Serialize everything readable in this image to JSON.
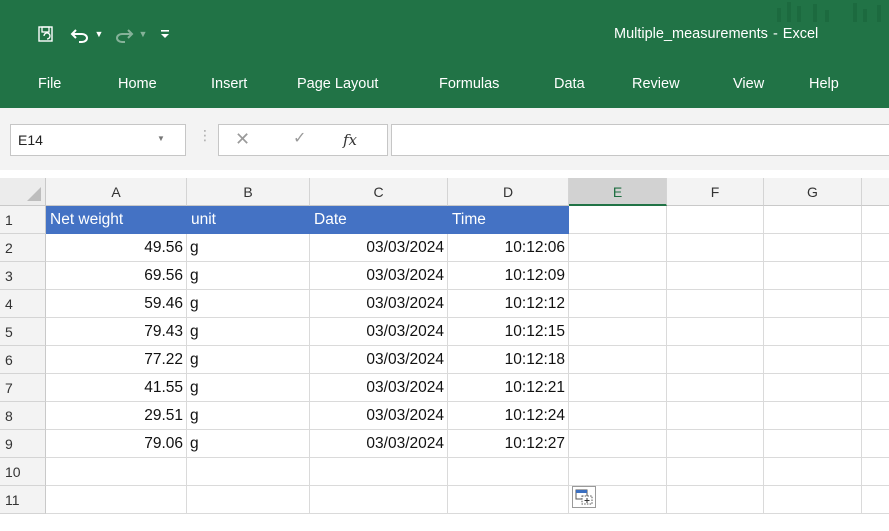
{
  "window": {
    "filename": "Multiple_measurements",
    "separator": "-",
    "app_name": "Excel"
  },
  "qat": {
    "save_icon": "save-icon",
    "undo_icon": "undo-icon",
    "redo_icon": "redo-icon",
    "customize_icon": "customize-qat-icon"
  },
  "ribbon": {
    "tabs": [
      "File",
      "Home",
      "Insert",
      "Page Layout",
      "Formulas",
      "Data",
      "Review",
      "View",
      "Help"
    ]
  },
  "formula_bar": {
    "name_box": "E14",
    "cancel_icon": "cancel-icon",
    "enter_icon": "enter-icon",
    "fx_label": "fx",
    "formula_value": ""
  },
  "sheet": {
    "active_column": "E",
    "columns": [
      "A",
      "B",
      "C",
      "D",
      "E",
      "F",
      "G"
    ],
    "row_numbers": [
      "1",
      "2",
      "3",
      "4",
      "5",
      "6",
      "7",
      "8",
      "9",
      "10",
      "11"
    ],
    "header_fill_color": "#4472c4",
    "headers": [
      "Net weight",
      "unit",
      "Date",
      "Time"
    ],
    "rows": [
      {
        "weight": "49.56",
        "unit": "g",
        "date": "03/03/2024",
        "time": "10:12:06"
      },
      {
        "weight": "69.56",
        "unit": "g",
        "date": "03/03/2024",
        "time": "10:12:09"
      },
      {
        "weight": "59.46",
        "unit": "g",
        "date": "03/03/2024",
        "time": "10:12:12"
      },
      {
        "weight": "79.43",
        "unit": "g",
        "date": "03/03/2024",
        "time": "10:12:15"
      },
      {
        "weight": "77.22",
        "unit": "g",
        "date": "03/03/2024",
        "time": "10:12:18"
      },
      {
        "weight": "41.55",
        "unit": "g",
        "date": "03/03/2024",
        "time": "10:12:21"
      },
      {
        "weight": "29.51",
        "unit": "g",
        "date": "03/03/2024",
        "time": "10:12:24"
      },
      {
        "weight": "79.06",
        "unit": "g",
        "date": "03/03/2024",
        "time": "10:12:27"
      }
    ],
    "paste_options_icon": "paste-options-icon"
  },
  "colors": {
    "accent": "#217346"
  }
}
